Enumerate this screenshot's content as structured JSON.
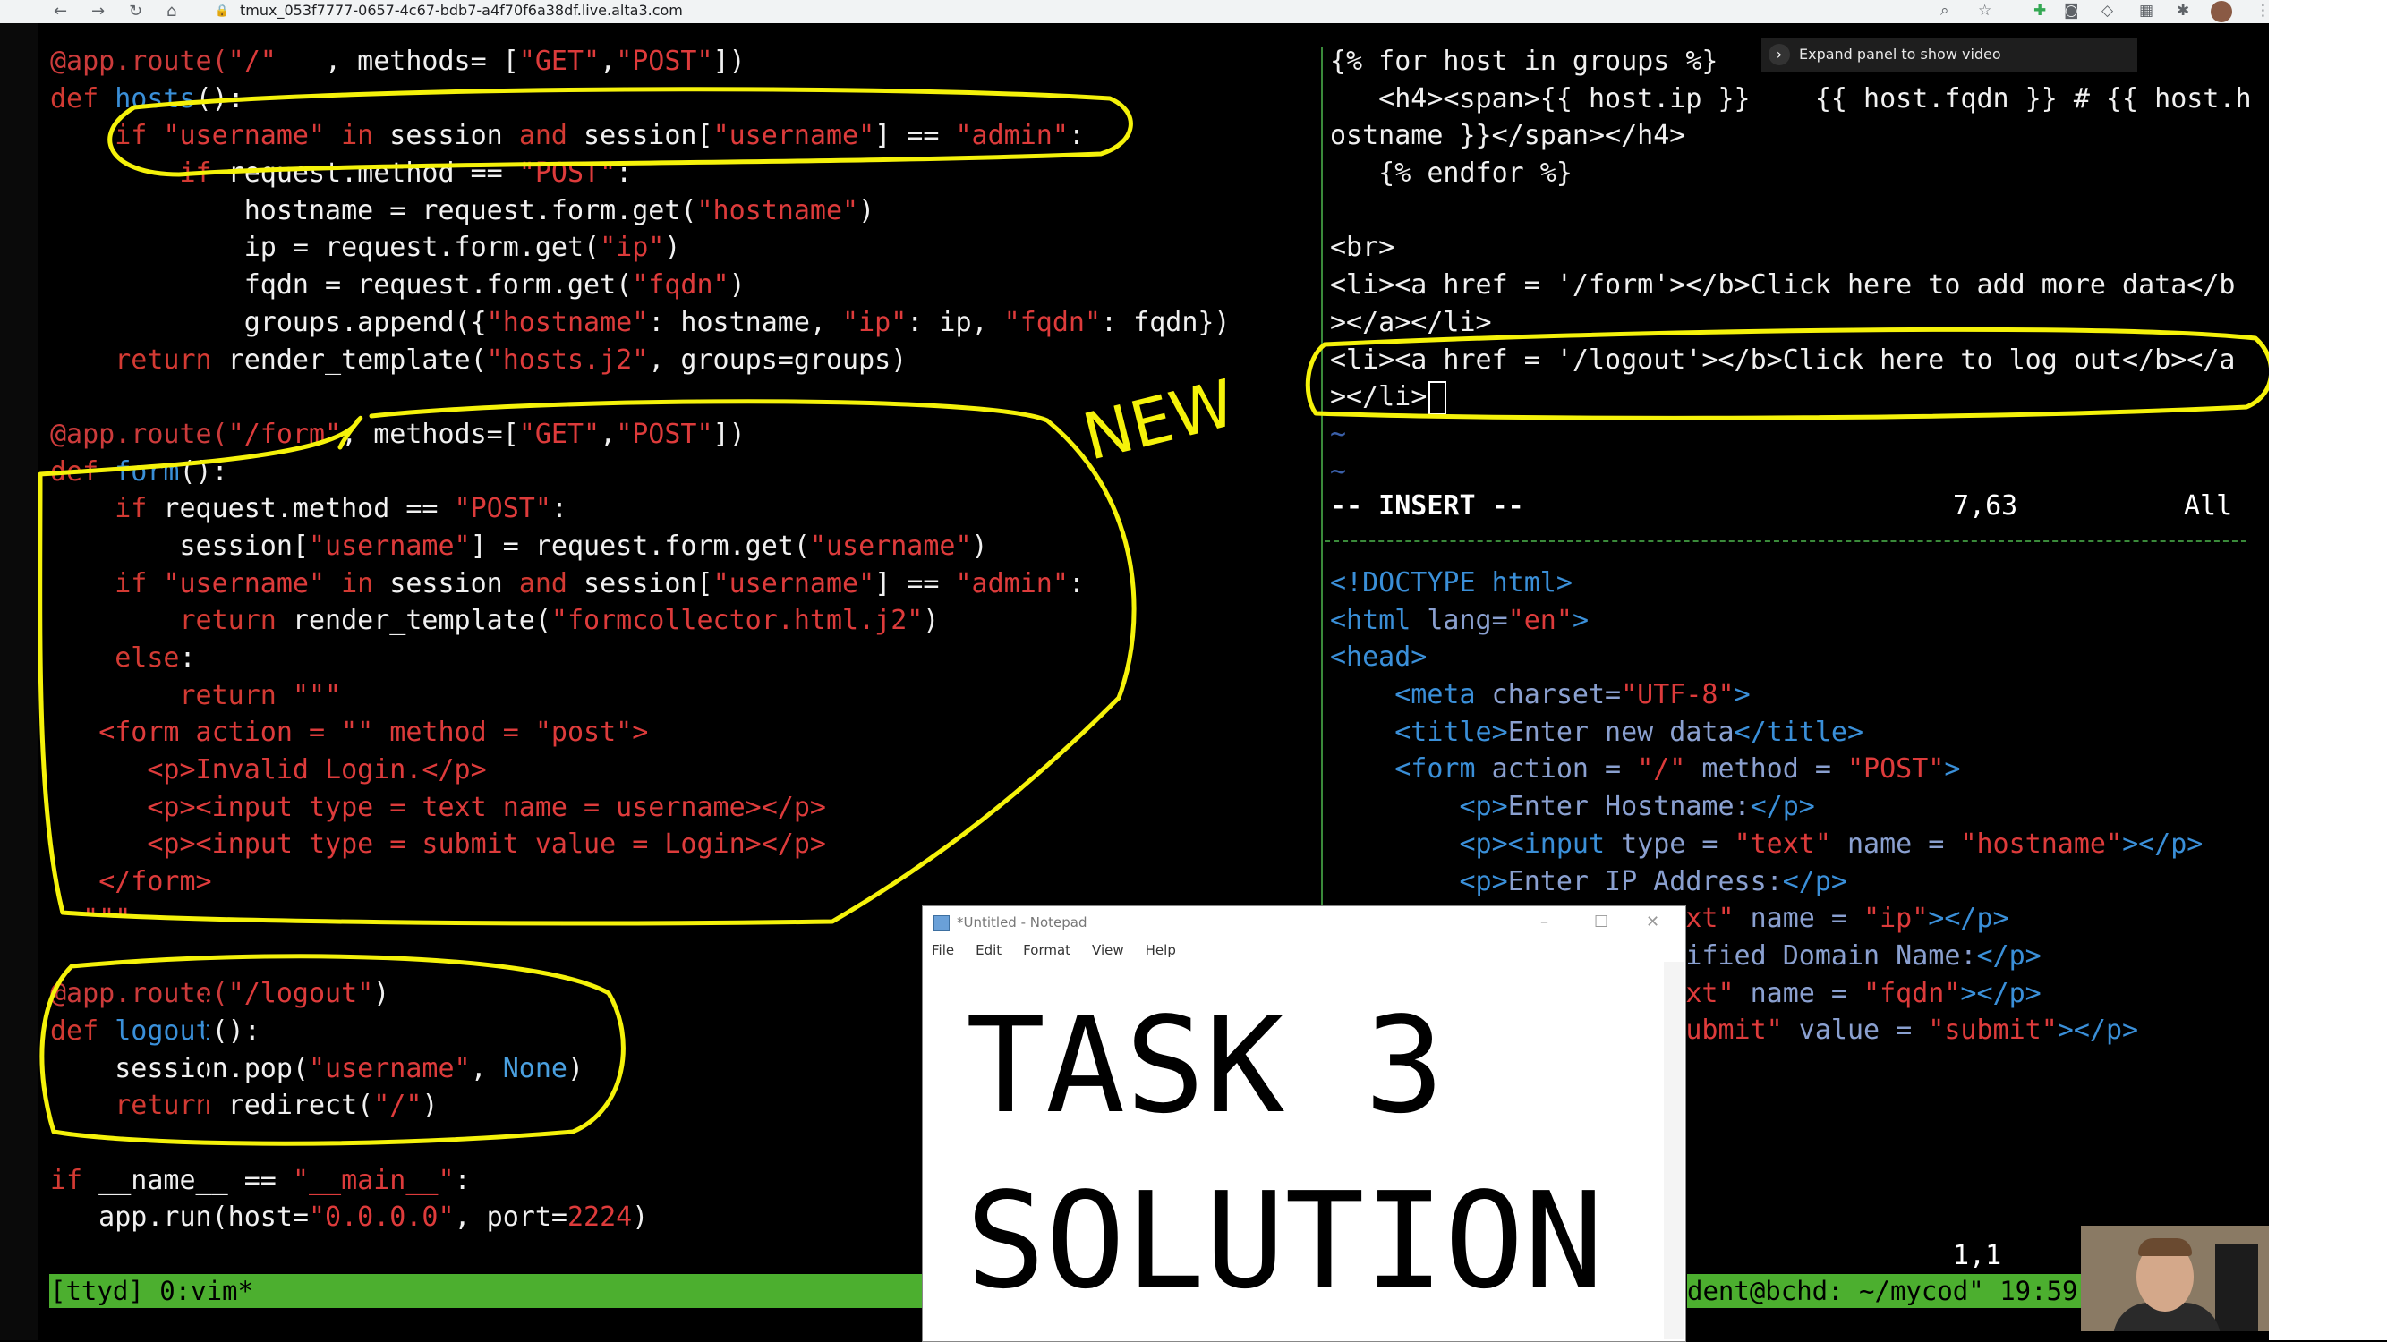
{
  "browser": {
    "url": "tmux_053f7777-0657-4c67-bdb7-a4f70f6a38df.live.alta3.com",
    "nav_back": "←",
    "nav_forward": "→",
    "nav_reload": "↻",
    "nav_home": "⌂",
    "lock": "🔒",
    "zoom_icon": "⌕",
    "star_icon": "☆",
    "menu_icon": "⋮"
  },
  "tooltip": {
    "chevron": "›",
    "text": "Expand panel to show video"
  },
  "left_pane": [
    [
      [
        "d",
        "@app.route("
      ],
      [
        "s",
        "\"/\""
      ],
      [
        "",
        "   , methods= ["
      ],
      [
        "s",
        "\"GET\""
      ],
      [
        "",
        ","
      ],
      [
        "s",
        "\"POST\""
      ],
      [
        "",
        "])"
      ]
    ],
    [
      [
        "k",
        "def"
      ],
      [
        "",
        " "
      ],
      [
        "n",
        "hosts"
      ],
      [
        "",
        "():"
      ]
    ],
    [
      [
        "",
        "    "
      ],
      [
        "k",
        "if"
      ],
      [
        "",
        " "
      ],
      [
        "s",
        "\"username\""
      ],
      [
        "",
        " "
      ],
      [
        "k",
        "in"
      ],
      [
        "",
        " session "
      ],
      [
        "k",
        "and"
      ],
      [
        "",
        " session["
      ],
      [
        "s",
        "\"username\""
      ],
      [
        "",
        "] == "
      ],
      [
        "s",
        "\"admin\""
      ],
      [
        "",
        ":"
      ]
    ],
    [
      [
        "",
        "        "
      ],
      [
        "k",
        "if"
      ],
      [
        "",
        " request.method == "
      ],
      [
        "s",
        "\"POST\""
      ],
      [
        "",
        ":"
      ]
    ],
    [
      [
        "",
        "            hostname = request.form.get("
      ],
      [
        "s",
        "\"hostname\""
      ],
      [
        "",
        ")"
      ]
    ],
    [
      [
        "",
        "            ip = request.form.get("
      ],
      [
        "s",
        "\"ip\""
      ],
      [
        "",
        ")"
      ]
    ],
    [
      [
        "",
        "            fqdn = request.form.get("
      ],
      [
        "s",
        "\"fqdn\""
      ],
      [
        "",
        ")"
      ]
    ],
    [
      [
        "",
        "            groups.append({"
      ],
      [
        "s",
        "\"hostname\""
      ],
      [
        "",
        ": hostname, "
      ],
      [
        "s",
        "\"ip\""
      ],
      [
        "",
        ": ip, "
      ],
      [
        "s",
        "\"fqdn\""
      ],
      [
        "",
        ": fqdn})"
      ]
    ],
    [
      [
        "",
        "    "
      ],
      [
        "k",
        "return"
      ],
      [
        "",
        " render_template("
      ],
      [
        "s",
        "\"hosts.j2\""
      ],
      [
        "",
        ", groups=groups)"
      ]
    ],
    [
      [
        "",
        ""
      ]
    ],
    [
      [
        "d",
        "@app.route("
      ],
      [
        "s",
        "\"/form\""
      ],
      [
        "",
        ", methods=["
      ],
      [
        "s",
        "\"GET\""
      ],
      [
        "",
        ","
      ],
      [
        "s",
        "\"POST\""
      ],
      [
        "",
        "])"
      ]
    ],
    [
      [
        "k",
        "def"
      ],
      [
        "",
        " "
      ],
      [
        "n",
        "form"
      ],
      [
        "",
        "():"
      ]
    ],
    [
      [
        "",
        "    "
      ],
      [
        "k",
        "if"
      ],
      [
        "",
        " request.method == "
      ],
      [
        "s",
        "\"POST\""
      ],
      [
        "",
        ":"
      ]
    ],
    [
      [
        "",
        "        session["
      ],
      [
        "s",
        "\"username\""
      ],
      [
        "",
        "] = request.form.get("
      ],
      [
        "s",
        "\"username\""
      ],
      [
        "",
        ")"
      ]
    ],
    [
      [
        "",
        "    "
      ],
      [
        "k",
        "if"
      ],
      [
        "",
        " "
      ],
      [
        "s",
        "\"username\""
      ],
      [
        "",
        " "
      ],
      [
        "k",
        "in"
      ],
      [
        "",
        " session "
      ],
      [
        "k",
        "and"
      ],
      [
        "",
        " session["
      ],
      [
        "s",
        "\"username\""
      ],
      [
        "",
        "] == "
      ],
      [
        "s",
        "\"admin\""
      ],
      [
        "",
        ":"
      ]
    ],
    [
      [
        "",
        "        "
      ],
      [
        "k",
        "return"
      ],
      [
        "",
        " render_template("
      ],
      [
        "s",
        "\"formcollector.html.j2\""
      ],
      [
        "",
        ")"
      ]
    ],
    [
      [
        "",
        "    "
      ],
      [
        "k",
        "else"
      ],
      [
        "",
        ":"
      ]
    ],
    [
      [
        "",
        "        "
      ],
      [
        "k",
        "return"
      ],
      [
        "",
        " "
      ],
      [
        "s",
        "\"\"\""
      ]
    ],
    [
      [
        "",
        "   "
      ],
      [
        "s",
        "<form action = \"\" method = \"post\">"
      ]
    ],
    [
      [
        "",
        "      "
      ],
      [
        "s",
        "<p>Invalid Login.</p>"
      ]
    ],
    [
      [
        "",
        "      "
      ],
      [
        "s",
        "<p><input type = text name = username></p>"
      ]
    ],
    [
      [
        "",
        "      "
      ],
      [
        "s",
        "<p><input type = submit value = Login></p>"
      ]
    ],
    [
      [
        "",
        "   "
      ],
      [
        "s",
        "</form>"
      ]
    ],
    [
      [
        "",
        "  "
      ],
      [
        "s",
        "\"\"\""
      ]
    ],
    [
      [
        "",
        ""
      ]
    ],
    [
      [
        "d",
        "@app.route("
      ],
      [
        "s",
        "\"/logout\""
      ],
      [
        "",
        ")"
      ]
    ],
    [
      [
        "k",
        "def"
      ],
      [
        "",
        " "
      ],
      [
        "n",
        "logout"
      ],
      [
        "",
        "():"
      ]
    ],
    [
      [
        "",
        "    session.pop("
      ],
      [
        "s",
        "\"username\""
      ],
      [
        "",
        ", "
      ],
      [
        "c",
        "None"
      ],
      [
        "",
        ")"
      ]
    ],
    [
      [
        "",
        "    "
      ],
      [
        "k",
        "return"
      ],
      [
        "",
        " redirect("
      ],
      [
        "s",
        "\"/\""
      ],
      [
        "",
        ")"
      ]
    ],
    [
      [
        "",
        ""
      ]
    ],
    [
      [
        "k",
        "if"
      ],
      [
        "",
        " __name__ == "
      ],
      [
        "s",
        "\"__main__\""
      ],
      [
        "",
        ":"
      ]
    ],
    [
      [
        "",
        "   app.run(host="
      ],
      [
        "s",
        "\"0.0.0.0\""
      ],
      [
        "",
        ", port="
      ],
      [
        "s",
        "2224"
      ],
      [
        "",
        ")"
      ]
    ]
  ],
  "right_top": [
    [
      [
        "",
        "{% for host in groups %}"
      ]
    ],
    [
      [
        "",
        "   <h4><span>{{ host.ip }}    {{ host.fqdn }} # {{ host.h"
      ]
    ],
    [
      [
        "",
        "ostname }}</span></h4>"
      ]
    ],
    [
      [
        "",
        "   {% endfor %}"
      ]
    ],
    [
      [
        "",
        ""
      ]
    ],
    [
      [
        "",
        "<br>"
      ]
    ],
    [
      [
        "",
        "<li><a href = '/form'></b>Click here to add more data</b"
      ]
    ],
    [
      [
        "",
        "></a></li>"
      ]
    ],
    [
      [
        "",
        "<li><a href = '/logout'></b>Click here to log out</b></a"
      ]
    ],
    [
      [
        "",
        "></li>"
      ]
    ]
  ],
  "right_tildes": [
    "~",
    "~"
  ],
  "vim": {
    "mode": "-- INSERT --",
    "position": "7,63",
    "scroll": "All",
    "bottom_position": "1,1"
  },
  "right_bottom": [
    [
      [
        "n",
        "<!DOCTYPE html>"
      ]
    ],
    [
      [
        "n",
        "<html "
      ],
      [
        "t",
        "lang="
      ],
      [
        "s",
        "\"en\""
      ],
      [
        "n",
        ">"
      ]
    ],
    [
      [
        "n",
        "<head>"
      ]
    ],
    [
      [
        "",
        "    "
      ],
      [
        "n",
        "<meta "
      ],
      [
        "t",
        "charset="
      ],
      [
        "s",
        "\"UTF-8\""
      ],
      [
        "n",
        ">"
      ]
    ],
    [
      [
        "",
        "    "
      ],
      [
        "n",
        "<title>"
      ],
      [
        "t",
        "Enter new data"
      ],
      [
        "n",
        "</title>"
      ]
    ],
    [
      [
        "",
        "    "
      ],
      [
        "n",
        "<form "
      ],
      [
        "t",
        "action = "
      ],
      [
        "s",
        "\"/\""
      ],
      [
        "t",
        " method = "
      ],
      [
        "s",
        "\"POST\""
      ],
      [
        "n",
        ">"
      ]
    ],
    [
      [
        "",
        "        "
      ],
      [
        "n",
        "<p>"
      ],
      [
        "t",
        "Enter Hostname:"
      ],
      [
        "n",
        "</p>"
      ]
    ],
    [
      [
        "",
        "        "
      ],
      [
        "n",
        "<p><input "
      ],
      [
        "t",
        "type = "
      ],
      [
        "s",
        "\"text\""
      ],
      [
        "t",
        " name = "
      ],
      [
        "s",
        "\"hostname\""
      ],
      [
        "n",
        "></p>"
      ]
    ],
    [
      [
        "",
        "        "
      ],
      [
        "n",
        "<p>"
      ],
      [
        "t",
        "Enter IP Address:"
      ],
      [
        "n",
        "</p>"
      ]
    ],
    [
      [
        "",
        "                 "
      ],
      [
        "t",
        "= "
      ],
      [
        "s",
        "\"text\""
      ],
      [
        "t",
        " name = "
      ],
      [
        "s",
        "\"ip\""
      ],
      [
        "n",
        "></p>"
      ]
    ],
    [
      [
        "",
        "                  "
      ],
      [
        "t",
        "Qualified Domain Name:"
      ],
      [
        "n",
        "</p>"
      ]
    ],
    [
      [
        "",
        "                 "
      ],
      [
        "t",
        "= "
      ],
      [
        "s",
        "\"text\""
      ],
      [
        "t",
        " name = "
      ],
      [
        "s",
        "\"fqdn\""
      ],
      [
        "n",
        "></p>"
      ]
    ],
    [
      [
        "",
        "                "
      ],
      [
        "t",
        "e = "
      ],
      [
        "s",
        "\"submit\""
      ],
      [
        "t",
        " value = "
      ],
      [
        "s",
        "\"submit\""
      ],
      [
        "n",
        "></p>"
      ]
    ]
  ],
  "tmux": {
    "left": "[ttyd] 0:vim*",
    "right": "dent@bchd: ~/mycod\" 19:59"
  },
  "annotation": {
    "new_label": "NEW"
  },
  "notepad": {
    "title": "*Untitled - Notepad",
    "menu": [
      "File",
      "Edit",
      "Format",
      "View",
      "Help"
    ],
    "minimize": "–",
    "maximize": "☐",
    "close": "✕",
    "line1": "TASK 3",
    "line2": "SOLUTION"
  },
  "colors": {
    "highlight": "#f5f20a",
    "tmux_green": "#4caf2f",
    "keyword_red": "#d33a33",
    "tag_blue": "#3a8fd8"
  }
}
